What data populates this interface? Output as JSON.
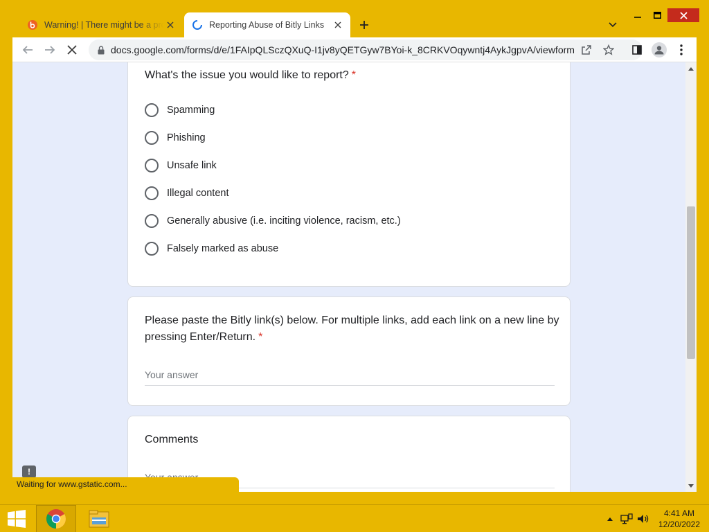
{
  "browser": {
    "tabs": [
      {
        "title": "Warning! | There might be a problem with the requested link",
        "active": false
      },
      {
        "title": "Reporting Abuse of Bitly Links",
        "active": true
      }
    ],
    "url": "docs.google.com/forms/d/e/1FAIpQLSczQXuQ-I1jv8yQETGyw7BYoi-k_8CRKVOqywntj4AykJgpvA/viewform",
    "status": "Waiting for www.gstatic.com..."
  },
  "form": {
    "issue_question": "What's the issue you would like to report?",
    "required_marker": "*",
    "issue_options": [
      "Spamming",
      "Phishing",
      "Unsafe link",
      "Illegal content",
      "Generally abusive (i.e. inciting violence, racism, etc.)",
      "Falsely marked as abuse"
    ],
    "links_question": "Please paste the Bitly link(s) below. For multiple links, add each link on a new line by pressing Enter/Return.",
    "answer_placeholder": "Your answer",
    "comments_question": "Comments"
  },
  "taskbar": {
    "time": "4:41 AM",
    "date": "12/20/2022"
  },
  "colors": {
    "frame": "#e8b700",
    "page_background": "#e6ecfb",
    "required": "#d93025",
    "close_button": "#c42b1c"
  },
  "icons": [
    "bitly-favicon-icon",
    "loading-spinner-icon",
    "close-icon",
    "plus-icon",
    "chevron-down-icon",
    "minimize-icon",
    "maximize-icon",
    "back-arrow-icon",
    "forward-arrow-icon",
    "stop-icon",
    "lock-icon",
    "share-icon",
    "star-icon",
    "side-panel-icon",
    "profile-icon",
    "kebab-menu-icon",
    "windows-logo-icon",
    "chrome-icon",
    "file-explorer-icon",
    "tray-chevron-icon",
    "network-icon",
    "volume-icon"
  ]
}
